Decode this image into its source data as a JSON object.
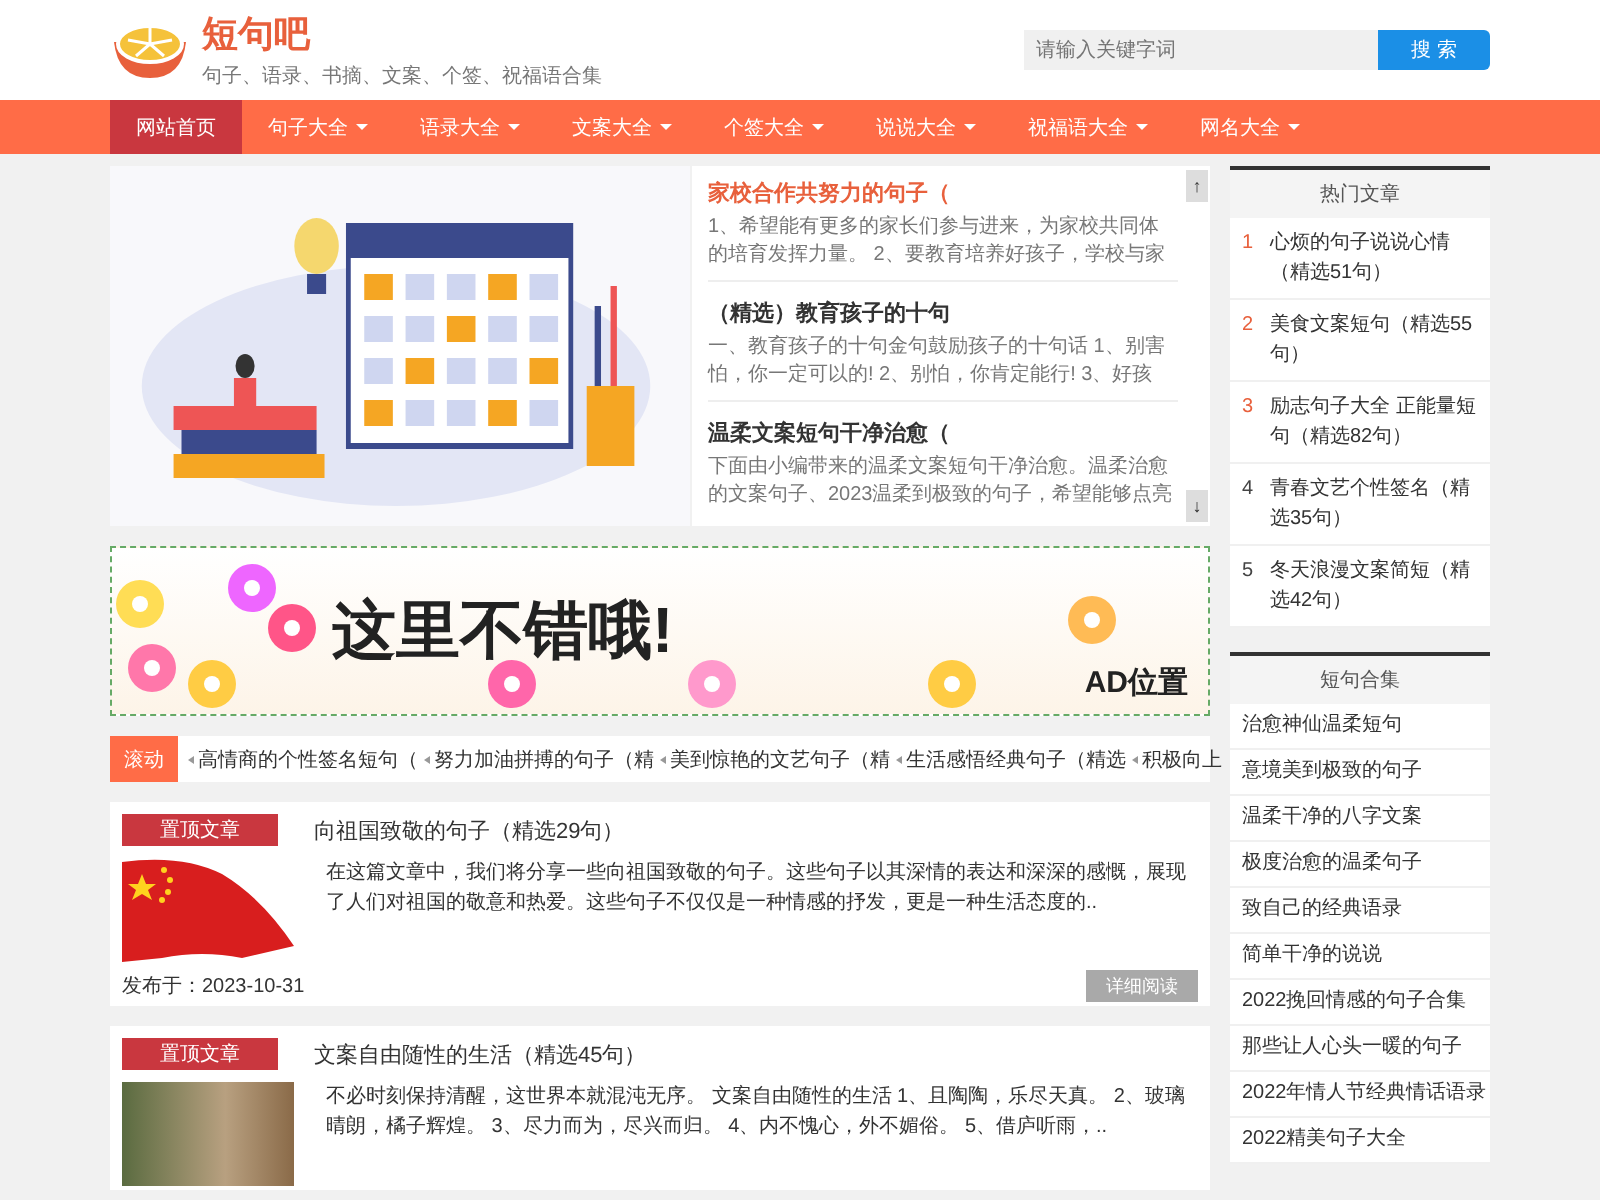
{
  "site": {
    "name": "短句吧",
    "tagline": "句子、语录、书摘、文案、个签、祝福语合集"
  },
  "search": {
    "placeholder": "请输入关键字词",
    "button": "搜 索"
  },
  "nav": [
    {
      "label": "网站首页",
      "selected": true,
      "dropdown": false
    },
    {
      "label": "句子大全",
      "selected": false,
      "dropdown": true
    },
    {
      "label": "语录大全",
      "selected": false,
      "dropdown": true
    },
    {
      "label": "文案大全",
      "selected": false,
      "dropdown": true
    },
    {
      "label": "个签大全",
      "selected": false,
      "dropdown": true
    },
    {
      "label": "说说大全",
      "selected": false,
      "dropdown": true
    },
    {
      "label": "祝福语大全",
      "selected": false,
      "dropdown": true
    },
    {
      "label": "网名大全",
      "selected": false,
      "dropdown": true
    }
  ],
  "featured": {
    "items": [
      {
        "title": "家校合作共努力的句子（",
        "excerpt": "1、希望能有更多的家长们参与进来，为家校共同体的培育发挥力量。 2、要教育培养好孩子，学校与家",
        "selected": true
      },
      {
        "title": "（精选）教育孩子的十句",
        "excerpt": "一、教育孩子的十句金句鼓励孩子的十句话 1、别害怕，你一定可以的! 2、别怕，你肯定能行! 3、好孩",
        "selected": false
      },
      {
        "title": "温柔文案短句干净治愈（",
        "excerpt": "下面由小编带来的温柔文案短句干净治愈。温柔治愈的文案句子、2023温柔到极致的句子，希望能够点亮",
        "selected": false
      }
    ],
    "scroll_up": "↑",
    "scroll_down": "↓"
  },
  "ad_banner": {
    "headline": "这里不错哦!",
    "label": "AD位置"
  },
  "ticker": {
    "label": "滚动",
    "items": [
      "高情商的个性签名短句（",
      "努力加油拼搏的句子（精",
      "美到惊艳的文艺句子（精",
      "生活感悟经典句子（精选",
      "积极向上"
    ]
  },
  "articles": [
    {
      "badge": "置顶文章",
      "title": "向祖国致敬的句子（精选29句）",
      "kind": "flag",
      "summary": "在这篇文章中，我们将分享一些向祖国致敬的句子。这些句子以其深情的表达和深深的感慨，展现了人们对祖国的敬意和热爱。这些句子不仅仅是一种情感的抒发，更是一种生活态度的..",
      "date": "发布于：2023-10-31",
      "more": "详细阅读"
    },
    {
      "badge": "置顶文章",
      "title": "文案自由随性的生活（精选45句）",
      "kind": "photo",
      "summary": "不必时刻保持清醒，这世界本就混沌无序。 文案自由随性的生活 1、且陶陶，乐尽天真。 2、玻璃晴朗，橘子辉煌。 3、尽力而为，尽兴而归。 4、内不愧心，外不媚俗。 5、借庐听雨，.."
    }
  ],
  "hot": {
    "title": "热门文章",
    "items": [
      {
        "rank": "1",
        "title": "心烦的句子说说心情（精选51句）",
        "color": "#e8603c"
      },
      {
        "rank": "2",
        "title": "美食文案短句（精选55句）",
        "color": "#e8603c"
      },
      {
        "rank": "3",
        "title": "励志句子大全 正能量短句（精选82句）",
        "color": "#e8603c"
      },
      {
        "rank": "4",
        "title": "青春文艺个性签名（精选35句）",
        "color": "#444444"
      },
      {
        "rank": "5",
        "title": "冬天浪漫文案简短（精选42句）",
        "color": "#444444"
      }
    ]
  },
  "collection": {
    "title": "短句合集",
    "items": [
      "治愈神仙温柔短句",
      "意境美到极致的句子",
      "温柔干净的八字文案",
      "极度治愈的温柔句子",
      "致自己的经典语录",
      "简单干净的说说",
      "2022挽回情感的句子合集",
      "那些让人心头一暖的句子",
      "2022年情人节经典情话语录",
      "2022精美句子大全"
    ]
  }
}
